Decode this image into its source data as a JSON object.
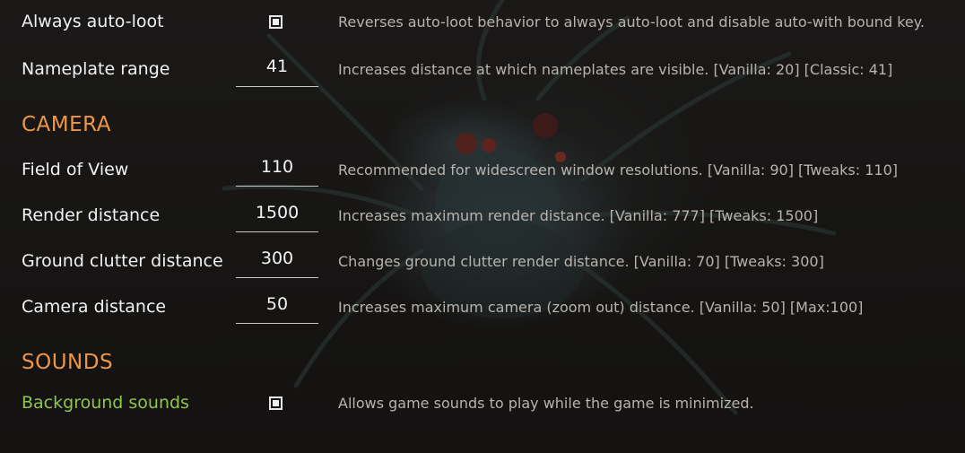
{
  "rows_top": [
    {
      "label": "Always auto-loot",
      "control": "checkbox",
      "checked": true,
      "description": "Reverses auto-loot behavior to always auto-loot and disable auto-with bound key."
    },
    {
      "label": "Nameplate range",
      "control": "field",
      "value": "41",
      "description": "Increases distance at which nameplates are visible. [Vanilla: 20] [Classic: 41]"
    }
  ],
  "camera": {
    "title": "CAMERA",
    "rows": [
      {
        "label": "Field of View",
        "value": "110",
        "description": "Recommended for widescreen window resolutions. [Vanilla: 90] [Tweaks: 110]"
      },
      {
        "label": "Render distance",
        "value": "1500",
        "description": "Increases maximum render distance. [Vanilla: 777] [Tweaks: 1500]"
      },
      {
        "label": "Ground clutter distance",
        "value": "300",
        "description": "Changes ground clutter render distance. [Vanilla: 70] [Tweaks: 300]"
      },
      {
        "label": "Camera distance",
        "value": "50",
        "description": "Increases maximum camera (zoom out) distance. [Vanilla: 50] [Max:100]"
      }
    ]
  },
  "sounds": {
    "title": "SOUNDS",
    "rows": [
      {
        "label": "Background sounds",
        "control": "checkbox",
        "checked": true,
        "highlighted": true,
        "description": "Allows game sounds to play while the game is minimized."
      }
    ]
  },
  "colors": {
    "section_title": "#ee9546",
    "label": "#f2f2f2",
    "label_highlight": "#8fc64a",
    "description": "#b8b3ad",
    "background": "#151413"
  }
}
